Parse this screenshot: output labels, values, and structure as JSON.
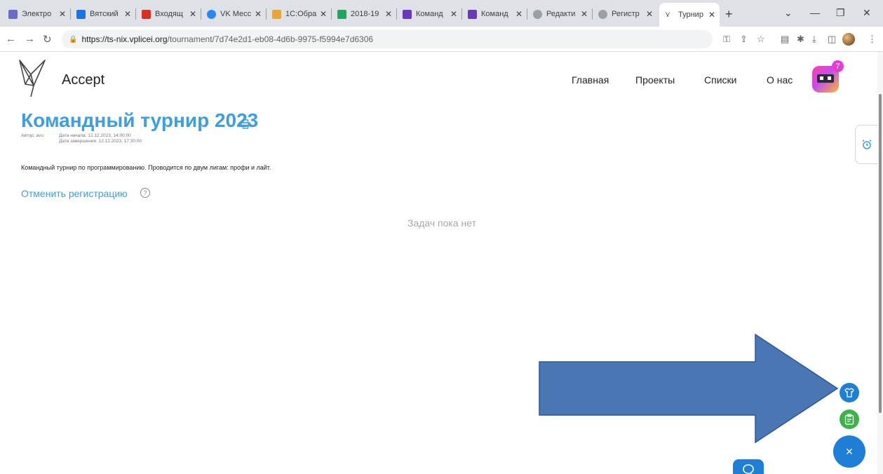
{
  "browser": {
    "tabs": [
      {
        "label": "Электро",
        "color": "#6b6bbf"
      },
      {
        "label": "Вятский",
        "color": "#1a73e8"
      },
      {
        "label": "Входящ",
        "color": "#d93025"
      },
      {
        "label": "VK Месс",
        "color": "#2787f5"
      },
      {
        "label": "1С:Обра",
        "color": "#e8a63a"
      },
      {
        "label": "2018-19",
        "color": "#1fa463"
      },
      {
        "label": "Команд",
        "color": "#673ab7"
      },
      {
        "label": "Команд",
        "color": "#673ab7"
      },
      {
        "label": "Редакти",
        "color": "#9aa0a6"
      },
      {
        "label": "Регистр",
        "color": "#9aa0a6"
      },
      {
        "label": "Турнир",
        "color": "#555555"
      }
    ],
    "url_host": "https://ts-nix.vplicei.org",
    "url_path": "/tournament/7d74e2d1-eb08-4d6b-9975-f5994e7d6306"
  },
  "site": {
    "brand": "Accept",
    "nav": [
      "Главная",
      "Проекты",
      "Списки",
      "О нас"
    ],
    "notification_count": "7"
  },
  "tournament": {
    "title": "Командный турнир 2023",
    "author": "Автор: avu",
    "start_date": "Дата начала: 12.12.2023, 14:00:00",
    "end_date": "Дата завершения: 12.12.2023, 17:30:00",
    "description": "Командный турнир по программированию. Проводится по двум лигам: профи и лайт.",
    "cancel_registration": "Отменить регистрацию",
    "help_glyph": "?",
    "empty_tasks": "Задач пока нет"
  },
  "widgets": {
    "close_glyph": "×"
  },
  "colors": {
    "accent": "#3d9ee0",
    "fab_blue": "#1f7fd7",
    "fab_green": "#3cb34a",
    "arrow_fill": "#4a76b4"
  }
}
